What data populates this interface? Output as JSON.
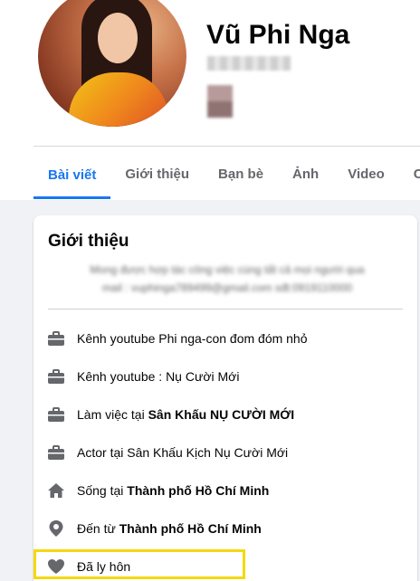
{
  "profile": {
    "name": "Vũ Phi Nga"
  },
  "tabs": [
    {
      "label": "Bài viết",
      "active": true
    },
    {
      "label": "Giới thiệu",
      "active": false
    },
    {
      "label": "Bạn bè",
      "active": false
    },
    {
      "label": "Ảnh",
      "active": false
    },
    {
      "label": "Video",
      "active": false
    },
    {
      "label": "Che",
      "active": false
    }
  ],
  "intro": {
    "title": "Giới thiệu",
    "bio_line1": "Mong được hợp tác công việc cùng tất cả mọi người qua",
    "bio_line2": "mail : vuphinga789499@gmail.com sđt:0919110000",
    "items": [
      {
        "icon": "briefcase-icon",
        "text": "Kênh youtube Phi nga-con đom đóm nhỏ",
        "bold": ""
      },
      {
        "icon": "briefcase-icon",
        "text": "Kênh youtube : Nụ Cười Mới",
        "bold": ""
      },
      {
        "icon": "briefcase-icon",
        "text": "Làm việc tại ",
        "bold": "Sân Khấu NỤ CƯỜI MỚI"
      },
      {
        "icon": "briefcase-icon",
        "text": "Actor tại Sân Khấu Kịch Nụ Cười Mới",
        "bold": ""
      },
      {
        "icon": "home-icon",
        "text": "Sống tại ",
        "bold": "Thành phố Hồ Chí Minh"
      },
      {
        "icon": "location-pin-icon",
        "text": "Đến từ ",
        "bold": "Thành phố Hồ Chí Minh"
      },
      {
        "icon": "heart-icon",
        "text": "Đã ly hôn",
        "bold": ""
      }
    ]
  },
  "colors": {
    "accent": "#1877f2",
    "highlight": "#f5d90f",
    "icon": "#65676b"
  }
}
